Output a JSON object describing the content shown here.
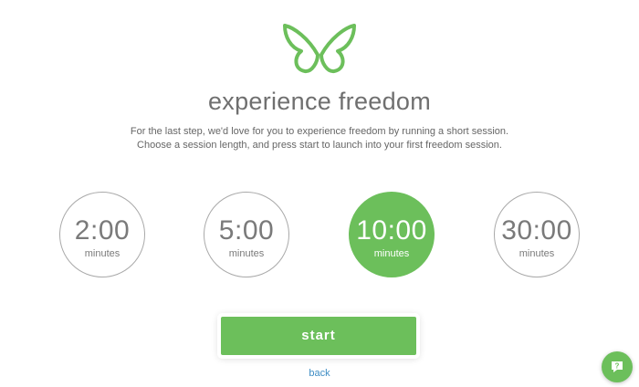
{
  "header": {
    "logo_icon": "butterfly-icon",
    "title": "experience freedom"
  },
  "intro": {
    "line1": "For the last step, we'd love for you to experience freedom by running a short session.",
    "line2": "Choose a session length, and press start to launch into your first freedom session."
  },
  "sessions": [
    {
      "time": "2:00",
      "unit": "minutes",
      "selected": false
    },
    {
      "time": "5:00",
      "unit": "minutes",
      "selected": false
    },
    {
      "time": "10:00",
      "unit": "minutes",
      "selected": true
    },
    {
      "time": "30:00",
      "unit": "minutes",
      "selected": false
    }
  ],
  "actions": {
    "start_label": "start",
    "back_label": "back"
  },
  "help": {
    "icon": "help-chat-icon"
  },
  "colors": {
    "accent": "#6cbf5b",
    "link": "#3e8dc4",
    "text": "#6f6f6f"
  }
}
